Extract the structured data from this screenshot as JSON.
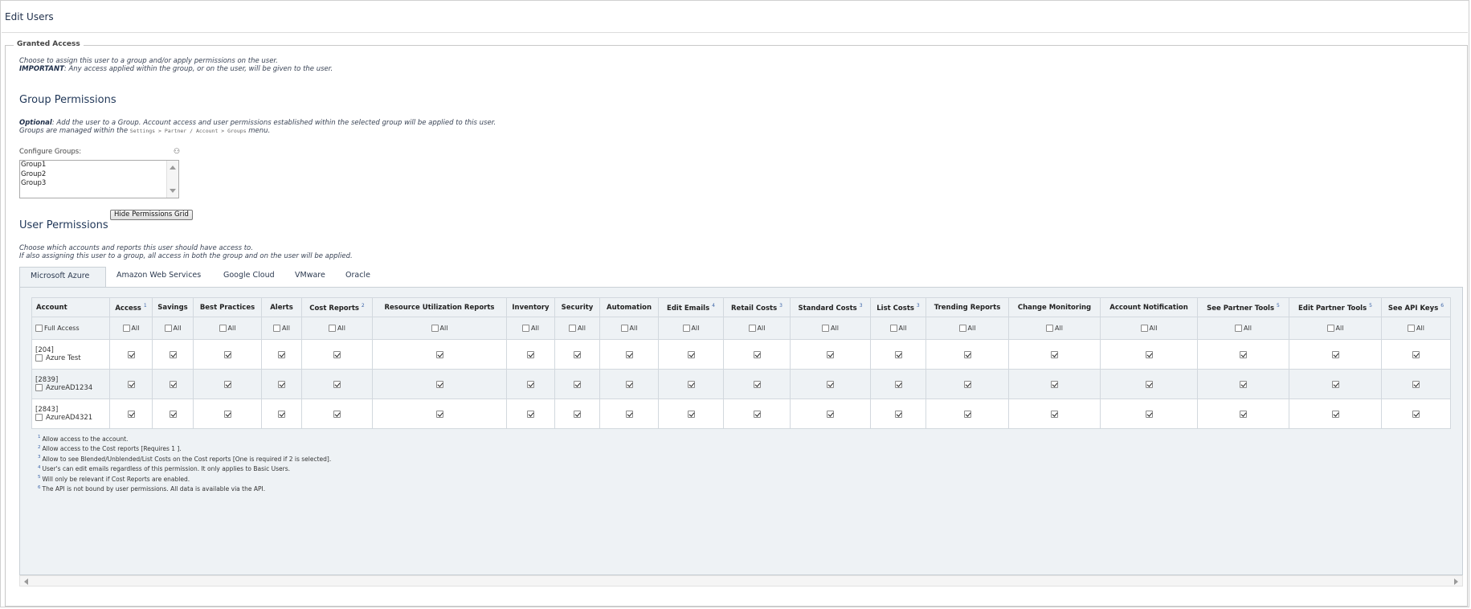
{
  "page": {
    "title": "Edit Users"
  },
  "granted_access": {
    "legend": "Granted Access",
    "intro_line1": "Choose to assign this user to a group and/or apply permissions on the user.",
    "important_label": "IMPORTANT",
    "important_text": ": Any access applied within the group, or on the user, will be given to the user."
  },
  "group_permissions": {
    "heading": "Group Permissions",
    "optional_label": "Optional",
    "optional_text": ": Add the user to a Group. Account access and user permissions established within the selected group will be applied to this user.",
    "managed_prefix": "Groups are managed within the",
    "managed_path": "Settings > Partner / Account > Groups",
    "managed_suffix": "menu.",
    "configure_label": "Configure Groups:",
    "groups": [
      "Group1",
      "Group2",
      "Group3"
    ],
    "binoculars_icon": "binoculars-icon"
  },
  "user_permissions": {
    "heading": "User Permissions",
    "toggle_button": "Hide Permissions Grid",
    "desc_line1": "Choose which accounts and reports this user should have access to.",
    "desc_line2": "If also assigning this user to a group, all access in both the group and on the user will be applied."
  },
  "tabs": [
    {
      "label": "Microsoft Azure",
      "active": true
    },
    {
      "label": "Amazon Web Services",
      "active": false
    },
    {
      "label": "Google Cloud",
      "active": false
    },
    {
      "label": "VMware",
      "active": false
    },
    {
      "label": "Oracle",
      "active": false
    }
  ],
  "grid": {
    "account_header": "Account",
    "full_access_label": "Full Access",
    "all_label": "All",
    "columns": [
      {
        "label": "Access",
        "note": "1"
      },
      {
        "label": "Savings",
        "note": ""
      },
      {
        "label": "Best Practices",
        "note": ""
      },
      {
        "label": "Alerts",
        "note": ""
      },
      {
        "label": "Cost Reports",
        "note": "2"
      },
      {
        "label": "Resource Utilization Reports",
        "note": ""
      },
      {
        "label": "Inventory",
        "note": ""
      },
      {
        "label": "Security",
        "note": ""
      },
      {
        "label": "Automation",
        "note": ""
      },
      {
        "label": "Edit Emails",
        "note": "4"
      },
      {
        "label": "Retail Costs",
        "note": "3"
      },
      {
        "label": "Standard Costs",
        "note": "3"
      },
      {
        "label": "List Costs",
        "note": "3"
      },
      {
        "label": "Trending Reports",
        "note": ""
      },
      {
        "label": "Change Monitoring",
        "note": ""
      },
      {
        "label": "Account Notification",
        "note": ""
      },
      {
        "label": "See Partner Tools",
        "note": "5"
      },
      {
        "label": "Edit Partner Tools",
        "note": "5"
      },
      {
        "label": "See API Keys",
        "note": "6"
      }
    ],
    "rows": [
      {
        "id": "[204]",
        "name": "Azure Test",
        "checked": true
      },
      {
        "id": "[2839]",
        "name": "AzureAD1234",
        "checked": true
      },
      {
        "id": "[2843]",
        "name": "AzureAD4321",
        "checked": true
      }
    ]
  },
  "notes": [
    {
      "n": "1",
      "text": "Allow access to the account."
    },
    {
      "n": "2",
      "text": "Allow access to the Cost reports [Requires  1 ]."
    },
    {
      "n": "3",
      "text": "Allow to see Blended/Unblended/List Costs on the Cost reports [One is required if  2  is selected]."
    },
    {
      "n": "4",
      "text": "User's can edit emails regardless of this permission. It only applies to Basic Users."
    },
    {
      "n": "5",
      "text": "Will only be relevant if Cost Reports are enabled."
    },
    {
      "n": "6",
      "text": "The API is not bound by user permissions. All data is available via the API."
    }
  ]
}
